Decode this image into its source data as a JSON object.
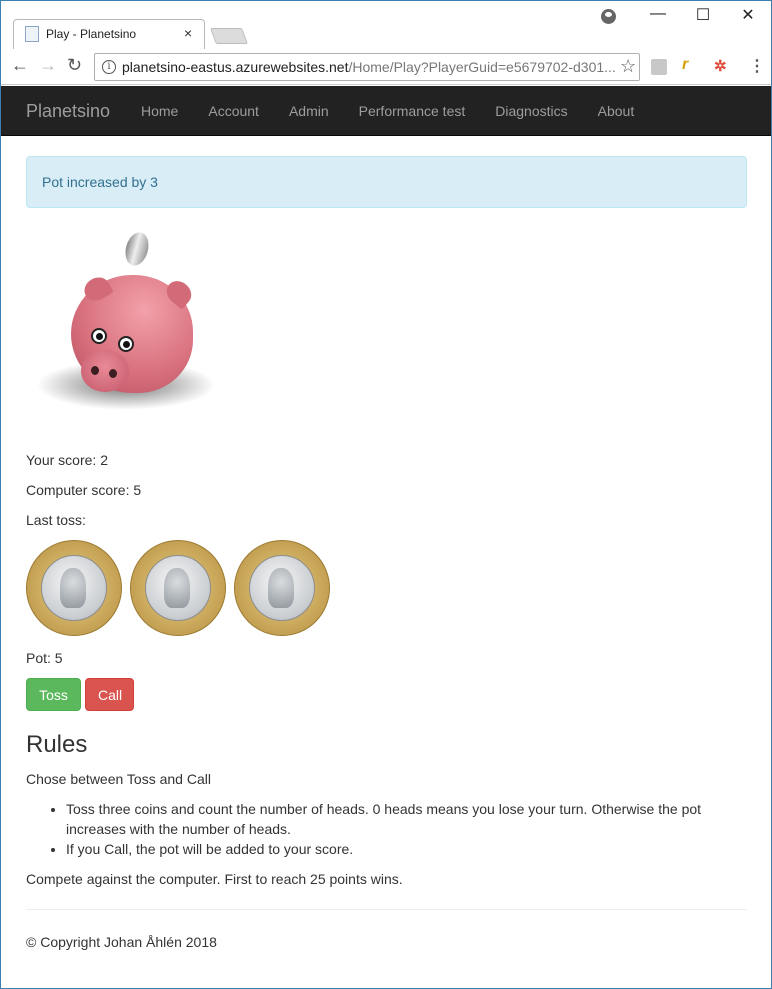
{
  "browser": {
    "tab_title": "Play - Planetsino",
    "tab_close": "×",
    "url_host": "planetsino-eastus.azurewebsites.net",
    "url_path": "/Home/Play?PlayerGuid=e5679702-d301...",
    "win_minimize": "—",
    "win_maximize": "☐",
    "win_close": "✕"
  },
  "navbar": {
    "brand": "Planetsino",
    "links": [
      "Home",
      "Account",
      "Admin",
      "Performance test",
      "Diagnostics",
      "About"
    ]
  },
  "alert": {
    "text": "Pot increased by 3"
  },
  "stats": {
    "your_score": "Your score: 2",
    "computer_score": "Computer score: 5",
    "last_toss": "Last toss:",
    "pot": "Pot: 5"
  },
  "buttons": {
    "toss": "Toss",
    "call": "Call"
  },
  "rules": {
    "heading": "Rules",
    "intro": "Chose between Toss and Call",
    "items": [
      "Toss three coins and count the number of heads. 0 heads means you lose your turn. Otherwise the pot increases with the number of heads.",
      "If you Call, the pot will be added to your score."
    ],
    "compete": "Compete against the computer. First to reach 25 points wins."
  },
  "footer": {
    "text": "© Copyright Johan Åhlén 2018"
  },
  "colors": {
    "navbar": "#222222",
    "alert_bg": "#d9edf7",
    "toss": "#5cb85c",
    "call": "#d9534f"
  }
}
